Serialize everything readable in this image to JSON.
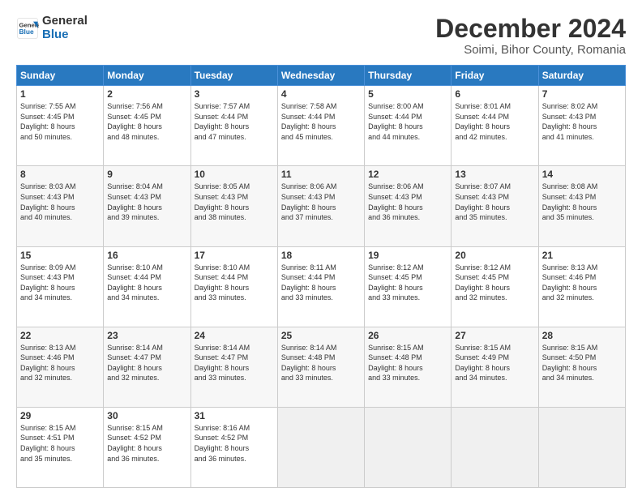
{
  "header": {
    "logo_line1": "General",
    "logo_line2": "Blue",
    "main_title": "December 2024",
    "subtitle": "Soimi, Bihor County, Romania"
  },
  "weekdays": [
    "Sunday",
    "Monday",
    "Tuesday",
    "Wednesday",
    "Thursday",
    "Friday",
    "Saturday"
  ],
  "weeks": [
    [
      {
        "day": "1",
        "lines": [
          "Sunrise: 7:55 AM",
          "Sunset: 4:45 PM",
          "Daylight: 8 hours",
          "and 50 minutes."
        ]
      },
      {
        "day": "2",
        "lines": [
          "Sunrise: 7:56 AM",
          "Sunset: 4:45 PM",
          "Daylight: 8 hours",
          "and 48 minutes."
        ]
      },
      {
        "day": "3",
        "lines": [
          "Sunrise: 7:57 AM",
          "Sunset: 4:44 PM",
          "Daylight: 8 hours",
          "and 47 minutes."
        ]
      },
      {
        "day": "4",
        "lines": [
          "Sunrise: 7:58 AM",
          "Sunset: 4:44 PM",
          "Daylight: 8 hours",
          "and 45 minutes."
        ]
      },
      {
        "day": "5",
        "lines": [
          "Sunrise: 8:00 AM",
          "Sunset: 4:44 PM",
          "Daylight: 8 hours",
          "and 44 minutes."
        ]
      },
      {
        "day": "6",
        "lines": [
          "Sunrise: 8:01 AM",
          "Sunset: 4:44 PM",
          "Daylight: 8 hours",
          "and 42 minutes."
        ]
      },
      {
        "day": "7",
        "lines": [
          "Sunrise: 8:02 AM",
          "Sunset: 4:43 PM",
          "Daylight: 8 hours",
          "and 41 minutes."
        ]
      }
    ],
    [
      {
        "day": "8",
        "lines": [
          "Sunrise: 8:03 AM",
          "Sunset: 4:43 PM",
          "Daylight: 8 hours",
          "and 40 minutes."
        ]
      },
      {
        "day": "9",
        "lines": [
          "Sunrise: 8:04 AM",
          "Sunset: 4:43 PM",
          "Daylight: 8 hours",
          "and 39 minutes."
        ]
      },
      {
        "day": "10",
        "lines": [
          "Sunrise: 8:05 AM",
          "Sunset: 4:43 PM",
          "Daylight: 8 hours",
          "and 38 minutes."
        ]
      },
      {
        "day": "11",
        "lines": [
          "Sunrise: 8:06 AM",
          "Sunset: 4:43 PM",
          "Daylight: 8 hours",
          "and 37 minutes."
        ]
      },
      {
        "day": "12",
        "lines": [
          "Sunrise: 8:06 AM",
          "Sunset: 4:43 PM",
          "Daylight: 8 hours",
          "and 36 minutes."
        ]
      },
      {
        "day": "13",
        "lines": [
          "Sunrise: 8:07 AM",
          "Sunset: 4:43 PM",
          "Daylight: 8 hours",
          "and 35 minutes."
        ]
      },
      {
        "day": "14",
        "lines": [
          "Sunrise: 8:08 AM",
          "Sunset: 4:43 PM",
          "Daylight: 8 hours",
          "and 35 minutes."
        ]
      }
    ],
    [
      {
        "day": "15",
        "lines": [
          "Sunrise: 8:09 AM",
          "Sunset: 4:43 PM",
          "Daylight: 8 hours",
          "and 34 minutes."
        ]
      },
      {
        "day": "16",
        "lines": [
          "Sunrise: 8:10 AM",
          "Sunset: 4:44 PM",
          "Daylight: 8 hours",
          "and 34 minutes."
        ]
      },
      {
        "day": "17",
        "lines": [
          "Sunrise: 8:10 AM",
          "Sunset: 4:44 PM",
          "Daylight: 8 hours",
          "and 33 minutes."
        ]
      },
      {
        "day": "18",
        "lines": [
          "Sunrise: 8:11 AM",
          "Sunset: 4:44 PM",
          "Daylight: 8 hours",
          "and 33 minutes."
        ]
      },
      {
        "day": "19",
        "lines": [
          "Sunrise: 8:12 AM",
          "Sunset: 4:45 PM",
          "Daylight: 8 hours",
          "and 33 minutes."
        ]
      },
      {
        "day": "20",
        "lines": [
          "Sunrise: 8:12 AM",
          "Sunset: 4:45 PM",
          "Daylight: 8 hours",
          "and 32 minutes."
        ]
      },
      {
        "day": "21",
        "lines": [
          "Sunrise: 8:13 AM",
          "Sunset: 4:46 PM",
          "Daylight: 8 hours",
          "and 32 minutes."
        ]
      }
    ],
    [
      {
        "day": "22",
        "lines": [
          "Sunrise: 8:13 AM",
          "Sunset: 4:46 PM",
          "Daylight: 8 hours",
          "and 32 minutes."
        ]
      },
      {
        "day": "23",
        "lines": [
          "Sunrise: 8:14 AM",
          "Sunset: 4:47 PM",
          "Daylight: 8 hours",
          "and 32 minutes."
        ]
      },
      {
        "day": "24",
        "lines": [
          "Sunrise: 8:14 AM",
          "Sunset: 4:47 PM",
          "Daylight: 8 hours",
          "and 33 minutes."
        ]
      },
      {
        "day": "25",
        "lines": [
          "Sunrise: 8:14 AM",
          "Sunset: 4:48 PM",
          "Daylight: 8 hours",
          "and 33 minutes."
        ]
      },
      {
        "day": "26",
        "lines": [
          "Sunrise: 8:15 AM",
          "Sunset: 4:48 PM",
          "Daylight: 8 hours",
          "and 33 minutes."
        ]
      },
      {
        "day": "27",
        "lines": [
          "Sunrise: 8:15 AM",
          "Sunset: 4:49 PM",
          "Daylight: 8 hours",
          "and 34 minutes."
        ]
      },
      {
        "day": "28",
        "lines": [
          "Sunrise: 8:15 AM",
          "Sunset: 4:50 PM",
          "Daylight: 8 hours",
          "and 34 minutes."
        ]
      }
    ],
    [
      {
        "day": "29",
        "lines": [
          "Sunrise: 8:15 AM",
          "Sunset: 4:51 PM",
          "Daylight: 8 hours",
          "and 35 minutes."
        ]
      },
      {
        "day": "30",
        "lines": [
          "Sunrise: 8:15 AM",
          "Sunset: 4:52 PM",
          "Daylight: 8 hours",
          "and 36 minutes."
        ]
      },
      {
        "day": "31",
        "lines": [
          "Sunrise: 8:16 AM",
          "Sunset: 4:52 PM",
          "Daylight: 8 hours",
          "and 36 minutes."
        ]
      },
      null,
      null,
      null,
      null
    ]
  ]
}
